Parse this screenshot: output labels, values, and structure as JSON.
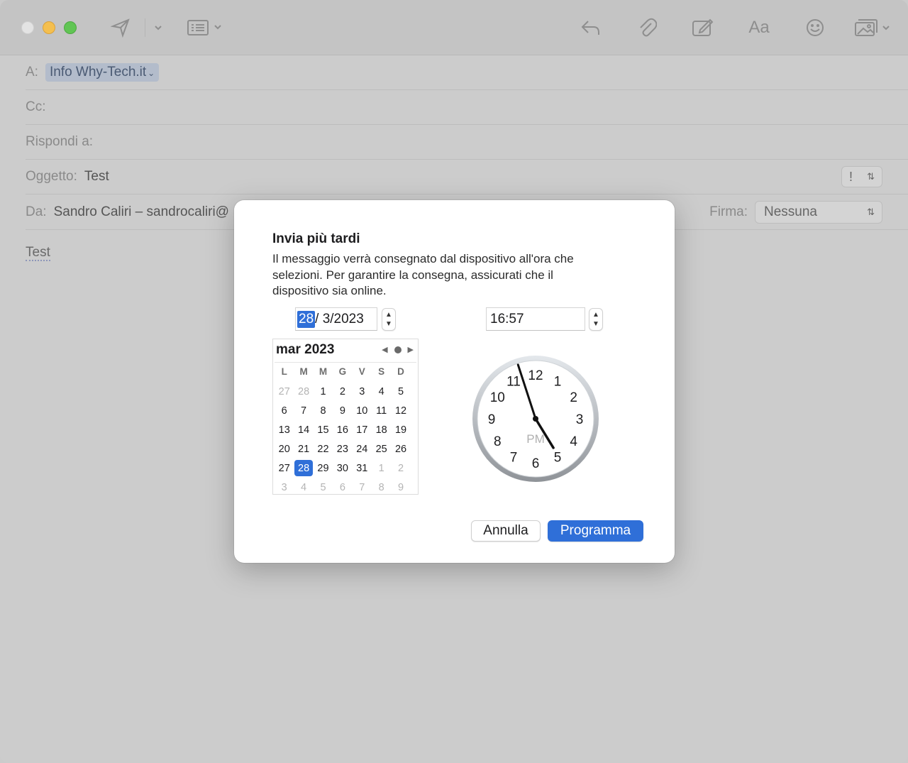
{
  "toolbar": {
    "icons": [
      "send-icon",
      "chevron-down-icon",
      "header-fields-icon",
      "reply-icon",
      "attachment-icon",
      "markup-icon",
      "format-icon",
      "emoji-icon",
      "photo-browser-icon"
    ],
    "format_label": "Aa"
  },
  "header": {
    "to_label": "A:",
    "to_value": "Info Why-Tech.it",
    "cc_label": "Cc:",
    "reply_to_label": "Rispondi a:",
    "subject_label": "Oggetto:",
    "subject_value": "Test",
    "priority_symbol": "!",
    "from_label": "Da:",
    "from_value": "Sandro Caliri – sandrocaliri@",
    "signature_label": "Firma:",
    "signature_value": "Nessuna"
  },
  "body": {
    "text": "Test"
  },
  "dialog": {
    "title": "Invia più tardi",
    "message": "Il messaggio verrà consegnato dal dispositivo all'ora che selezioni. Per garantire la consegna, assicurati che il dispositivo sia online.",
    "date_day": "28",
    "date_rest": "/  3/2023",
    "time": "16:57",
    "calendar": {
      "month_label": "mar 2023",
      "weekdays": [
        "L",
        "M",
        "M",
        "G",
        "V",
        "S",
        "D"
      ],
      "weeks": [
        [
          {
            "d": "27",
            "m": true
          },
          {
            "d": "28",
            "m": true
          },
          {
            "d": "1"
          },
          {
            "d": "2"
          },
          {
            "d": "3"
          },
          {
            "d": "4"
          },
          {
            "d": "5"
          }
        ],
        [
          {
            "d": "6"
          },
          {
            "d": "7"
          },
          {
            "d": "8"
          },
          {
            "d": "9"
          },
          {
            "d": "10"
          },
          {
            "d": "11"
          },
          {
            "d": "12"
          }
        ],
        [
          {
            "d": "13"
          },
          {
            "d": "14"
          },
          {
            "d": "15"
          },
          {
            "d": "16"
          },
          {
            "d": "17"
          },
          {
            "d": "18"
          },
          {
            "d": "19"
          }
        ],
        [
          {
            "d": "20"
          },
          {
            "d": "21"
          },
          {
            "d": "22"
          },
          {
            "d": "23"
          },
          {
            "d": "24"
          },
          {
            "d": "25"
          },
          {
            "d": "26"
          }
        ],
        [
          {
            "d": "27"
          },
          {
            "d": "28",
            "s": true
          },
          {
            "d": "29"
          },
          {
            "d": "30"
          },
          {
            "d": "31"
          },
          {
            "d": "1",
            "m": true
          },
          {
            "d": "2",
            "m": true
          }
        ],
        [
          {
            "d": "3",
            "m": true
          },
          {
            "d": "4",
            "m": true
          },
          {
            "d": "5",
            "m": true
          },
          {
            "d": "6",
            "m": true
          },
          {
            "d": "7",
            "m": true
          },
          {
            "d": "8",
            "m": true
          },
          {
            "d": "9",
            "m": true
          }
        ]
      ]
    },
    "clock": {
      "hour": 16,
      "minute": 57,
      "period": "PM",
      "numbers": [
        "12",
        "1",
        "2",
        "3",
        "4",
        "5",
        "6",
        "7",
        "8",
        "9",
        "10",
        "11"
      ]
    },
    "cancel_label": "Annulla",
    "schedule_label": "Programma"
  },
  "colors": {
    "accent": "#2f6fd8",
    "dimmed_background": "#cccccc"
  }
}
